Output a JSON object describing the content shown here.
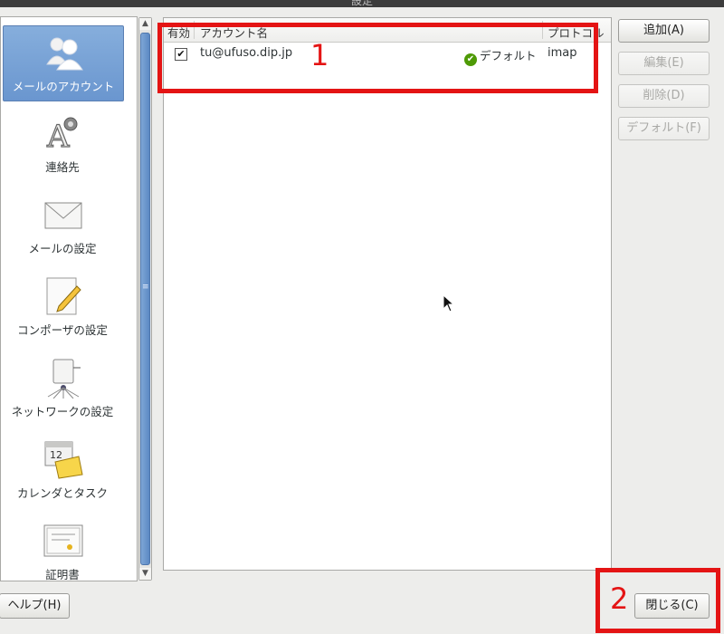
{
  "window": {
    "title": "設定"
  },
  "sidebar": {
    "items": [
      {
        "label": "メールのアカウント",
        "icon": "accounts-icon",
        "selected": true
      },
      {
        "label": "連絡先",
        "icon": "contacts-icon",
        "selected": false
      },
      {
        "label": "メールの設定",
        "icon": "mail-envelope-icon",
        "selected": false
      },
      {
        "label": "コンポーザの設定",
        "icon": "composer-pencil-icon",
        "selected": false
      },
      {
        "label": "ネットワークの設定",
        "icon": "network-icon",
        "selected": false
      },
      {
        "label": "カレンダとタスク",
        "icon": "calendar-icon",
        "selected": false
      },
      {
        "label": "証明書",
        "icon": "certificate-icon",
        "selected": false
      }
    ]
  },
  "accounts": {
    "columns": {
      "enabled": "有効",
      "name": "アカウント名",
      "protocol": "プロトコル"
    },
    "rows": [
      {
        "enabled": true,
        "name": "tu@ufuso.dip.jp",
        "default_label": "デフォルト",
        "protocol": "imap"
      }
    ]
  },
  "actions": {
    "add": "追加(A)",
    "edit": "編集(E)",
    "delete": "削除(D)",
    "default": "デフォルト(F)"
  },
  "footer": {
    "help": "ヘルプ(H)",
    "close": "閉じる(C)"
  },
  "annotations": {
    "one": "1",
    "two": "2"
  },
  "colors": {
    "annotation": "#e41414",
    "selection": "#6a96cf"
  }
}
